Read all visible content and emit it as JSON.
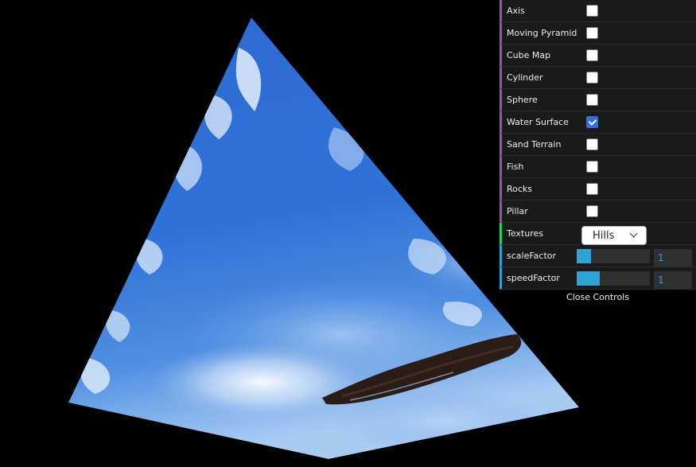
{
  "controls": {
    "axis": {
      "label": "Axis",
      "checked": false
    },
    "moving_pyramid": {
      "label": "Moving Pyramid",
      "checked": false
    },
    "cube_map": {
      "label": "Cube Map",
      "checked": false
    },
    "cylinder": {
      "label": "Cylinder",
      "checked": false
    },
    "sphere": {
      "label": "Sphere",
      "checked": false
    },
    "water_surface": {
      "label": "Water Surface",
      "checked": true
    },
    "sand_terrain": {
      "label": "Sand Terrain",
      "checked": false
    },
    "fish": {
      "label": "Fish",
      "checked": false
    },
    "rocks": {
      "label": "Rocks",
      "checked": false
    },
    "pillar": {
      "label": "Pillar",
      "checked": false
    },
    "textures": {
      "label": "Textures",
      "value": "Hills"
    },
    "scale_factor": {
      "label": "scaleFactor",
      "value": "1",
      "fill_fraction": 0.2
    },
    "speed_factor": {
      "label": "speedFactor",
      "value": "1",
      "fill_fraction": 0.31
    },
    "close_label": "Close Controls"
  },
  "colors": {
    "background": "#000000",
    "sky_blue": "#2f6fd0",
    "checkbox_accent": "#2f6fde",
    "number_accent": "#2fa1d6",
    "boolean_stripe": "#806787",
    "option_stripe": "#1ed36f"
  }
}
